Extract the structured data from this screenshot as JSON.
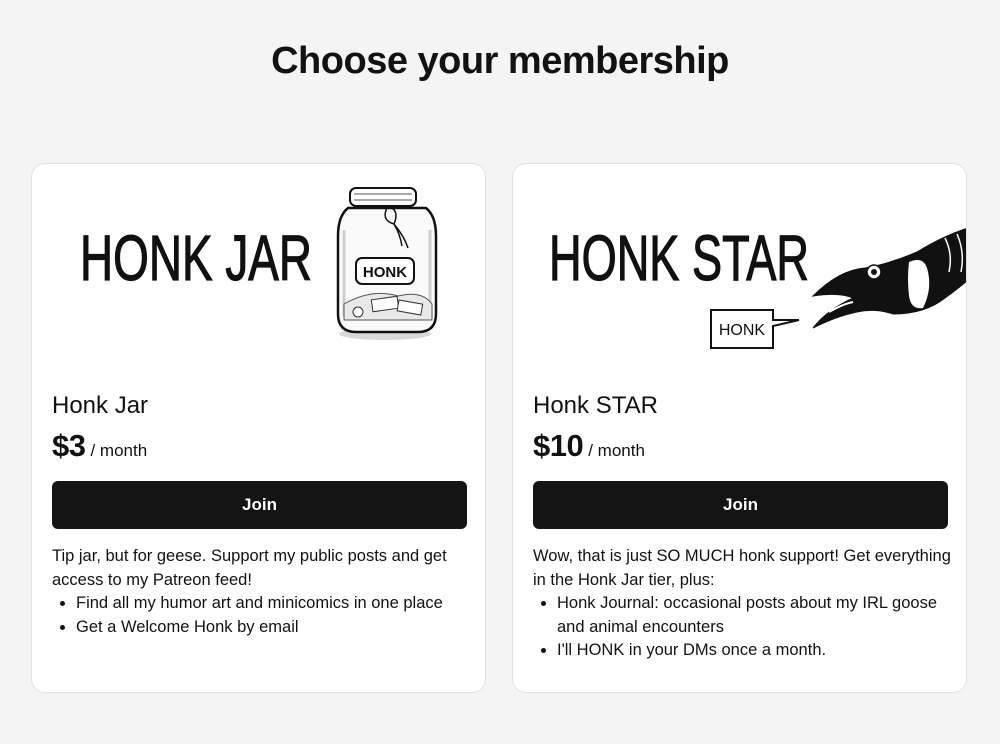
{
  "page": {
    "title": "Choose your membership"
  },
  "tiers": [
    {
      "banner_text": "HONK JAR",
      "banner_label": "HONK",
      "name": "Honk Jar",
      "price": "$3",
      "period": "/ month",
      "join_label": "Join",
      "description": "Tip jar, but for geese. Support my public posts and get access to my Patreon feed!",
      "benefits": [
        "Find all my humor art and minicomics in one place",
        "Get a Welcome Honk by email"
      ]
    },
    {
      "banner_text": "HONK STAR",
      "banner_label": "HONK",
      "name": "Honk STAR",
      "price": "$10",
      "period": "/ month",
      "join_label": "Join",
      "description": "Wow, that is just SO MUCH honk support! Get everything in the Honk Jar tier, plus:",
      "benefits": [
        "Honk Journal: occasional posts about my IRL goose and animal encounters",
        "I'll HONK in your DMs once a month."
      ]
    }
  ],
  "colors": {
    "background": "#f4f4f4",
    "card": "#ffffff",
    "button": "#141414",
    "button_text": "#ffffff"
  }
}
